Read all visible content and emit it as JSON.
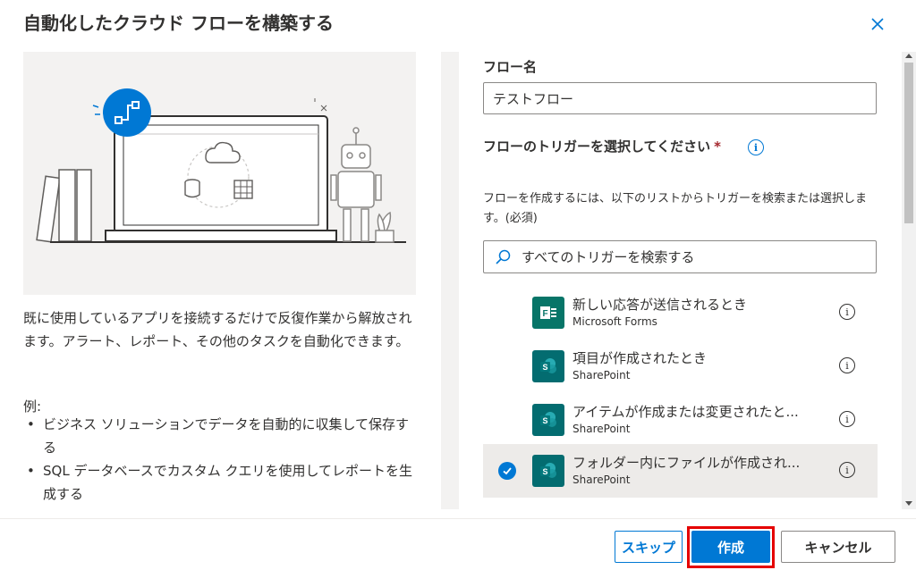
{
  "dialog": {
    "title": "自動化したクラウド フローを構築する",
    "description": "既に使用しているアプリを接続するだけで反復作業から解放されます。アラート、レポート、その他のタスクを自動化できます。",
    "examples_label": "例:",
    "examples": [
      "ビジネス ソリューションでデータを自動的に収集して保存する",
      "SQL データベースでカスタム クエリを使用してレポートを生成する"
    ]
  },
  "form": {
    "flow_name_label": "フロー名",
    "flow_name_value": "テストフロー",
    "trigger_label": "フローのトリガーを選択してください",
    "required_marker": "*",
    "helper_text": "フローを作成するには、以下のリストからトリガーを検索または選択します。(必須)",
    "search_placeholder": "すべてのトリガーを検索する"
  },
  "triggers": [
    {
      "title": "新しい応答が送信されるとき",
      "source": "Microsoft Forms",
      "icon": "forms-icon",
      "selected": false
    },
    {
      "title": "項目が作成されたとき",
      "source": "SharePoint",
      "icon": "sharepoint-icon",
      "selected": false
    },
    {
      "title": "アイテムが作成または変更されたと...",
      "source": "SharePoint",
      "icon": "sharepoint-icon",
      "selected": false
    },
    {
      "title": "フォルダー内にファイルが作成され...",
      "source": "SharePoint",
      "icon": "sharepoint-icon",
      "selected": true
    }
  ],
  "footer": {
    "skip_label": "スキップ",
    "create_label": "作成",
    "cancel_label": "キャンセル"
  },
  "colors": {
    "accent": "#0078d4",
    "highlight_border": "#e50000",
    "sharepoint": "#036c70",
    "forms": "#077568"
  }
}
